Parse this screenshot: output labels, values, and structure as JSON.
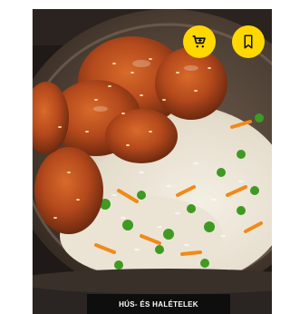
{
  "card": {
    "category_label": "HÚS- ÉS HALÉTELEK",
    "image_description_icon": "food-photo",
    "actions": {
      "cart_icon": "shopping-cart-icon",
      "bookmark_icon": "bookmark-icon"
    }
  },
  "colors": {
    "accent": "#ffd800",
    "label_bg": "#0e0e0e",
    "label_text": "#ffffff"
  }
}
